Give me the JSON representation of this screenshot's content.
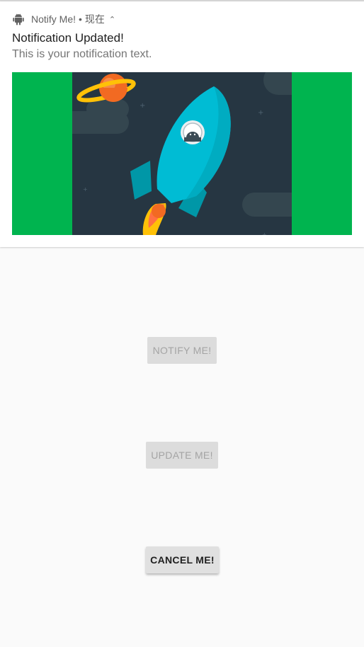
{
  "notification": {
    "app_name": "Notify Me!",
    "separator": "•",
    "time": "现在",
    "title": "Notification Updated!",
    "text": "This is your notification text.",
    "image_background": "#00b44f"
  },
  "buttons": {
    "notify_label": "NOTIFY ME!",
    "update_label": "UPDATE ME!",
    "cancel_label": "CANCEL ME!"
  }
}
